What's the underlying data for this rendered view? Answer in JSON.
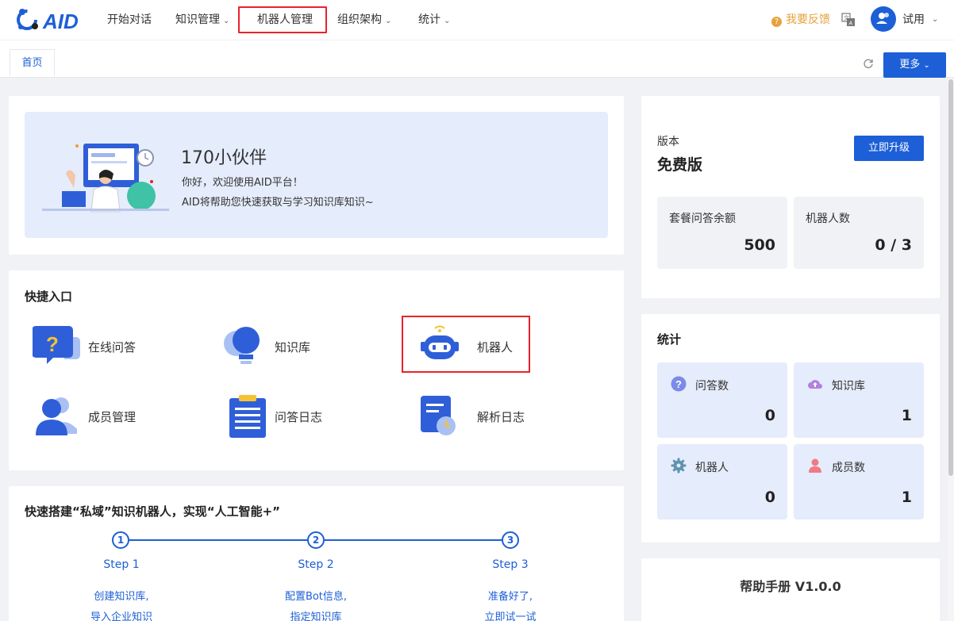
{
  "nav": {
    "items": [
      {
        "label": "开始对话",
        "dropdown": false
      },
      {
        "label": "知识管理",
        "dropdown": true
      },
      {
        "label": "机器人管理",
        "dropdown": false,
        "highlighted": true
      },
      {
        "label": "组织架构",
        "dropdown": true
      },
      {
        "label": "统计",
        "dropdown": true
      }
    ],
    "feedback": "我要反馈",
    "user": "试用"
  },
  "tabs": {
    "home": "首页",
    "more": "更多"
  },
  "welcome": {
    "title": "170小伙伴",
    "line1": "你好，欢迎使用AID平台！",
    "line2": "AID将帮助您快速获取与学习知识库知识~"
  },
  "quick": {
    "title": "快捷入口",
    "items": [
      {
        "label": "在线问答",
        "icon": "question-bubble-icon"
      },
      {
        "label": "知识库",
        "icon": "lightbulb-icon"
      },
      {
        "label": "机器人",
        "icon": "robot-icon",
        "highlighted": true
      },
      {
        "label": "成员管理",
        "icon": "users-icon"
      },
      {
        "label": "问答日志",
        "icon": "clipboard-icon"
      },
      {
        "label": "解析日志",
        "icon": "document-clock-icon"
      }
    ]
  },
  "steps": {
    "title": "快速搭建“私域”知识机器人，实现“人工智能+”",
    "items": [
      {
        "num": "1",
        "label": "Step 1",
        "desc1": "创建知识库,",
        "desc2": "导入企业知识"
      },
      {
        "num": "2",
        "label": "Step 2",
        "desc1": "配置Bot信息,",
        "desc2": "指定知识库"
      },
      {
        "num": "3",
        "label": "Step 3",
        "desc1": "准备好了,",
        "desc2": "立即试一试"
      }
    ]
  },
  "version": {
    "label": "版本",
    "value": "免费版",
    "upgrade": "立即升级",
    "quota_label": "套餐问答余额",
    "quota_value": "500",
    "robots_label": "机器人数",
    "robots_value": "0 / 3"
  },
  "stats": {
    "title": "统计",
    "items": [
      {
        "label": "问答数",
        "value": "0",
        "icon": "question-circle-icon"
      },
      {
        "label": "知识库",
        "value": "1",
        "icon": "cloud-upload-icon"
      },
      {
        "label": "机器人",
        "value": "0",
        "icon": "gear-icon"
      },
      {
        "label": "成员数",
        "value": "1",
        "icon": "person-icon"
      }
    ]
  },
  "help": {
    "title": "帮助手册 V1.0.0"
  },
  "colors": {
    "primary": "#1d5fd6",
    "highlight": "#e8232a",
    "feedback": "#e6a23c",
    "banner": "#e5ecfb"
  }
}
